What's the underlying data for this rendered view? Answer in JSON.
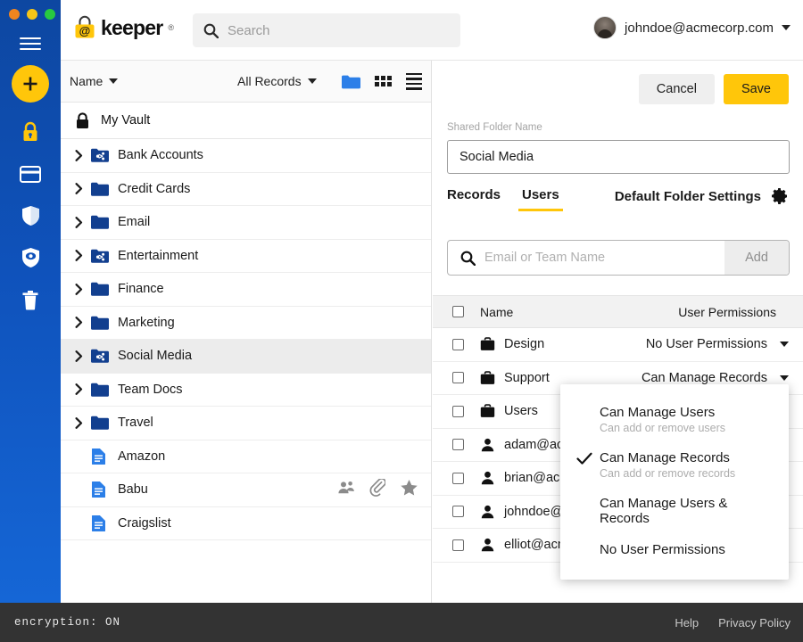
{
  "window": {
    "traffic_lights": [
      "close",
      "minimize",
      "maximize"
    ]
  },
  "rail": {
    "menu_icon": "hamburger-icon",
    "add_button_label": "+",
    "items": [
      {
        "name": "vault",
        "icon": "lock-icon",
        "active": true
      },
      {
        "name": "payments",
        "icon": "credit-card-icon",
        "active": false
      },
      {
        "name": "security-audit",
        "icon": "shield-icon",
        "active": false
      },
      {
        "name": "breachwatch",
        "icon": "shield-eye-icon",
        "active": false
      },
      {
        "name": "trash",
        "icon": "trash-icon",
        "active": false
      }
    ]
  },
  "topbar": {
    "logo_text": "keeper",
    "logo_tm": "®",
    "search": {
      "placeholder": "Search",
      "value": ""
    },
    "account": {
      "email": "johndoe@acmecorp.com"
    }
  },
  "vault_toolbar": {
    "sort_label": "Name",
    "filter_label": "All Records",
    "views": [
      "folder-view-icon",
      "grid-view-icon",
      "list-view-icon"
    ]
  },
  "vault_tree": {
    "root_label": "My Vault",
    "items": [
      {
        "label": "Bank Accounts",
        "type": "shared-folder",
        "expandable": true,
        "selected": false
      },
      {
        "label": "Credit Cards",
        "type": "folder",
        "expandable": true,
        "selected": false
      },
      {
        "label": "Email",
        "type": "folder",
        "expandable": true,
        "selected": false
      },
      {
        "label": "Entertainment",
        "type": "shared-folder",
        "expandable": true,
        "selected": false
      },
      {
        "label": "Finance",
        "type": "folder",
        "expandable": true,
        "selected": false
      },
      {
        "label": "Marketing",
        "type": "folder",
        "expandable": true,
        "selected": false
      },
      {
        "label": "Social Media",
        "type": "shared-folder",
        "expandable": true,
        "selected": true
      },
      {
        "label": "Team Docs",
        "type": "folder",
        "expandable": true,
        "selected": false
      },
      {
        "label": "Travel",
        "type": "folder",
        "expandable": true,
        "selected": false
      },
      {
        "label": "Amazon",
        "type": "record",
        "expandable": false,
        "selected": false,
        "badges": []
      },
      {
        "label": "Babu",
        "type": "record",
        "expandable": false,
        "selected": false,
        "badges": [
          "shared-users-icon",
          "attachment-icon",
          "favorite-star-icon"
        ]
      },
      {
        "label": "Craigslist",
        "type": "record",
        "expandable": false,
        "selected": false,
        "badges": []
      }
    ]
  },
  "panel": {
    "cancel_label": "Cancel",
    "save_label": "Save",
    "field_label": "Shared Folder Name",
    "folder_name_value": "Social Media",
    "folder_name_placeholder": "Shared Folder Name",
    "tabs": [
      {
        "label": "Records",
        "active": false
      },
      {
        "label": "Users",
        "active": true
      }
    ],
    "default_folder_settings_label": "Default Folder Settings",
    "add_input": {
      "placeholder": "Email or Team Name",
      "value": ""
    },
    "add_button_label": "Add",
    "table": {
      "columns": [
        "Name",
        "User Permissions"
      ],
      "rows": [
        {
          "name": "Design",
          "icon": "team-briefcase-icon",
          "permission": "No User Permissions",
          "checked": false
        },
        {
          "name": "Support",
          "icon": "team-briefcase-icon",
          "permission": "Can Manage Records",
          "checked": false
        },
        {
          "name": "Users",
          "icon": "team-briefcase-icon",
          "permission": "",
          "checked": false
        },
        {
          "name": "adam@acme",
          "icon": "user-person-icon",
          "permission": "",
          "checked": false
        },
        {
          "name": "brian@acme",
          "icon": "user-person-icon",
          "permission": "",
          "checked": false
        },
        {
          "name": "johndoe@ac",
          "icon": "user-person-icon",
          "permission": "",
          "checked": false
        },
        {
          "name": "elliot@acme",
          "icon": "user-person-icon",
          "permission": "",
          "checked": false
        }
      ]
    },
    "permission_menu": {
      "options": [
        {
          "title": "Can Manage Users",
          "subtitle": "Can add or remove users",
          "checked": false
        },
        {
          "title": "Can Manage Records",
          "subtitle": "Can add or remove records",
          "checked": true
        },
        {
          "title": "Can Manage Users & Records",
          "subtitle": "",
          "checked": false
        },
        {
          "title": "No User Permissions",
          "subtitle": "",
          "checked": false
        }
      ]
    }
  },
  "footer": {
    "encryption_text": "encryption: ON",
    "help_label": "Help",
    "privacy_label": "Privacy Policy"
  },
  "colors": {
    "brand_yellow": "#ffc60a",
    "rail_blue": "#0f52bb",
    "folder_blue": "#123f8f",
    "footer_dark": "#333333"
  }
}
